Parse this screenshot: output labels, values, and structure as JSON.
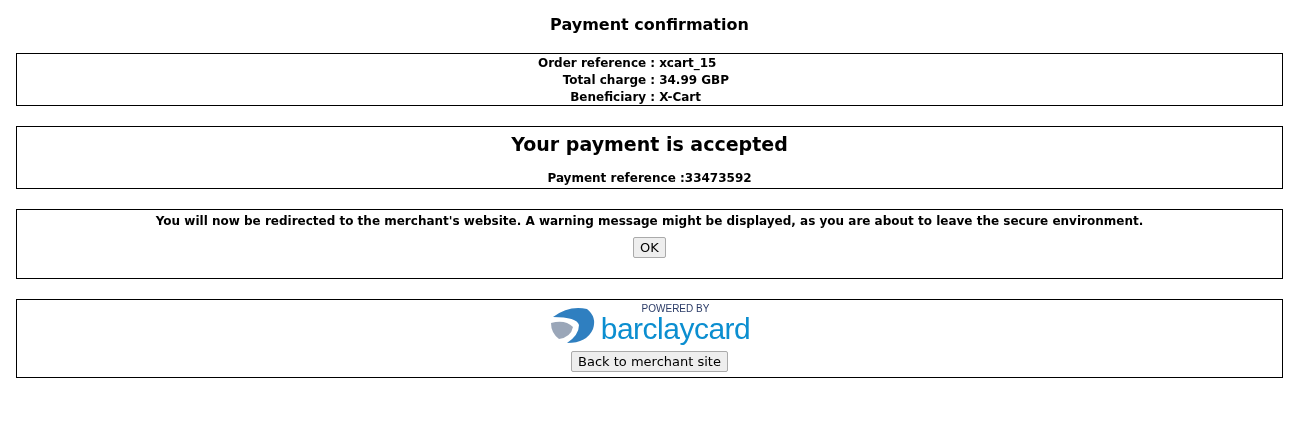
{
  "title": "Payment confirmation",
  "order_details": [
    {
      "label": "Order reference :",
      "value": "xcart_15"
    },
    {
      "label": "Total charge :",
      "value": "34.99 GBP"
    },
    {
      "label": "Beneficiary :",
      "value": "X-Cart"
    }
  ],
  "result": {
    "heading": "Your payment is accepted",
    "reference_label": "Payment reference :",
    "reference_value": "33473592"
  },
  "redirect": {
    "message": "You will now be redirected to the merchant's website. A warning message might be displayed, as you are about to leave the secure environment.",
    "button": "OK"
  },
  "footer": {
    "logo": {
      "tagline": "POWERED BY",
      "wordmark": "barclaycard"
    },
    "button": "Back to merchant site"
  }
}
